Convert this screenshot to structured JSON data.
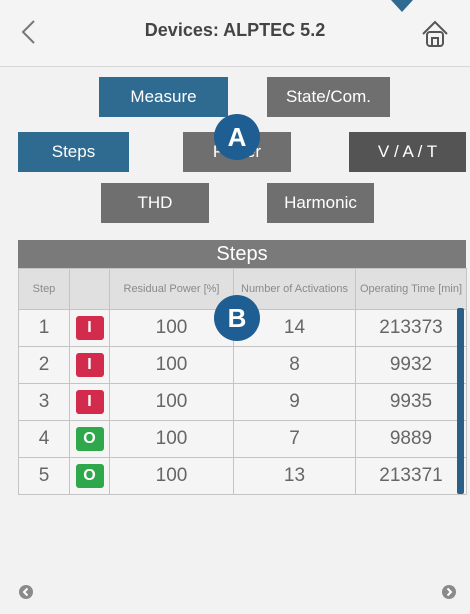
{
  "header": {
    "title": "Devices: ALPTEC 5.2"
  },
  "tabs_top": {
    "measure": "Measure",
    "state": "State/Com."
  },
  "tabs_mid": {
    "steps": "Steps",
    "power": "Power",
    "vat": "V / A / T"
  },
  "tabs_low": {
    "thd": "THD",
    "harmonic": "Harmonic"
  },
  "badges": {
    "a": "A",
    "b": "B"
  },
  "table": {
    "title": "Steps",
    "columns": [
      "Step",
      "",
      "Residual Power [%]",
      "Number of Activations",
      "Operating Time [min]"
    ],
    "rows": [
      {
        "step": "1",
        "state": "I",
        "power": "100",
        "activations": "14",
        "time": "213373"
      },
      {
        "step": "2",
        "state": "I",
        "power": "100",
        "activations": "8",
        "time": "9932"
      },
      {
        "step": "3",
        "state": "I",
        "power": "100",
        "activations": "9",
        "time": "9935"
      },
      {
        "step": "4",
        "state": "O",
        "power": "100",
        "activations": "7",
        "time": "9889"
      },
      {
        "step": "5",
        "state": "O",
        "power": "100",
        "activations": "13",
        "time": "213371"
      }
    ]
  },
  "colors": {
    "accent": "#2f6b91",
    "on": "#d22b4b",
    "off": "#2ea84a",
    "badge": "#1f5e93"
  },
  "icons": {
    "back": "chevron-left-icon",
    "home": "home-icon",
    "prev": "circle-left-icon",
    "next": "circle-right-icon"
  }
}
